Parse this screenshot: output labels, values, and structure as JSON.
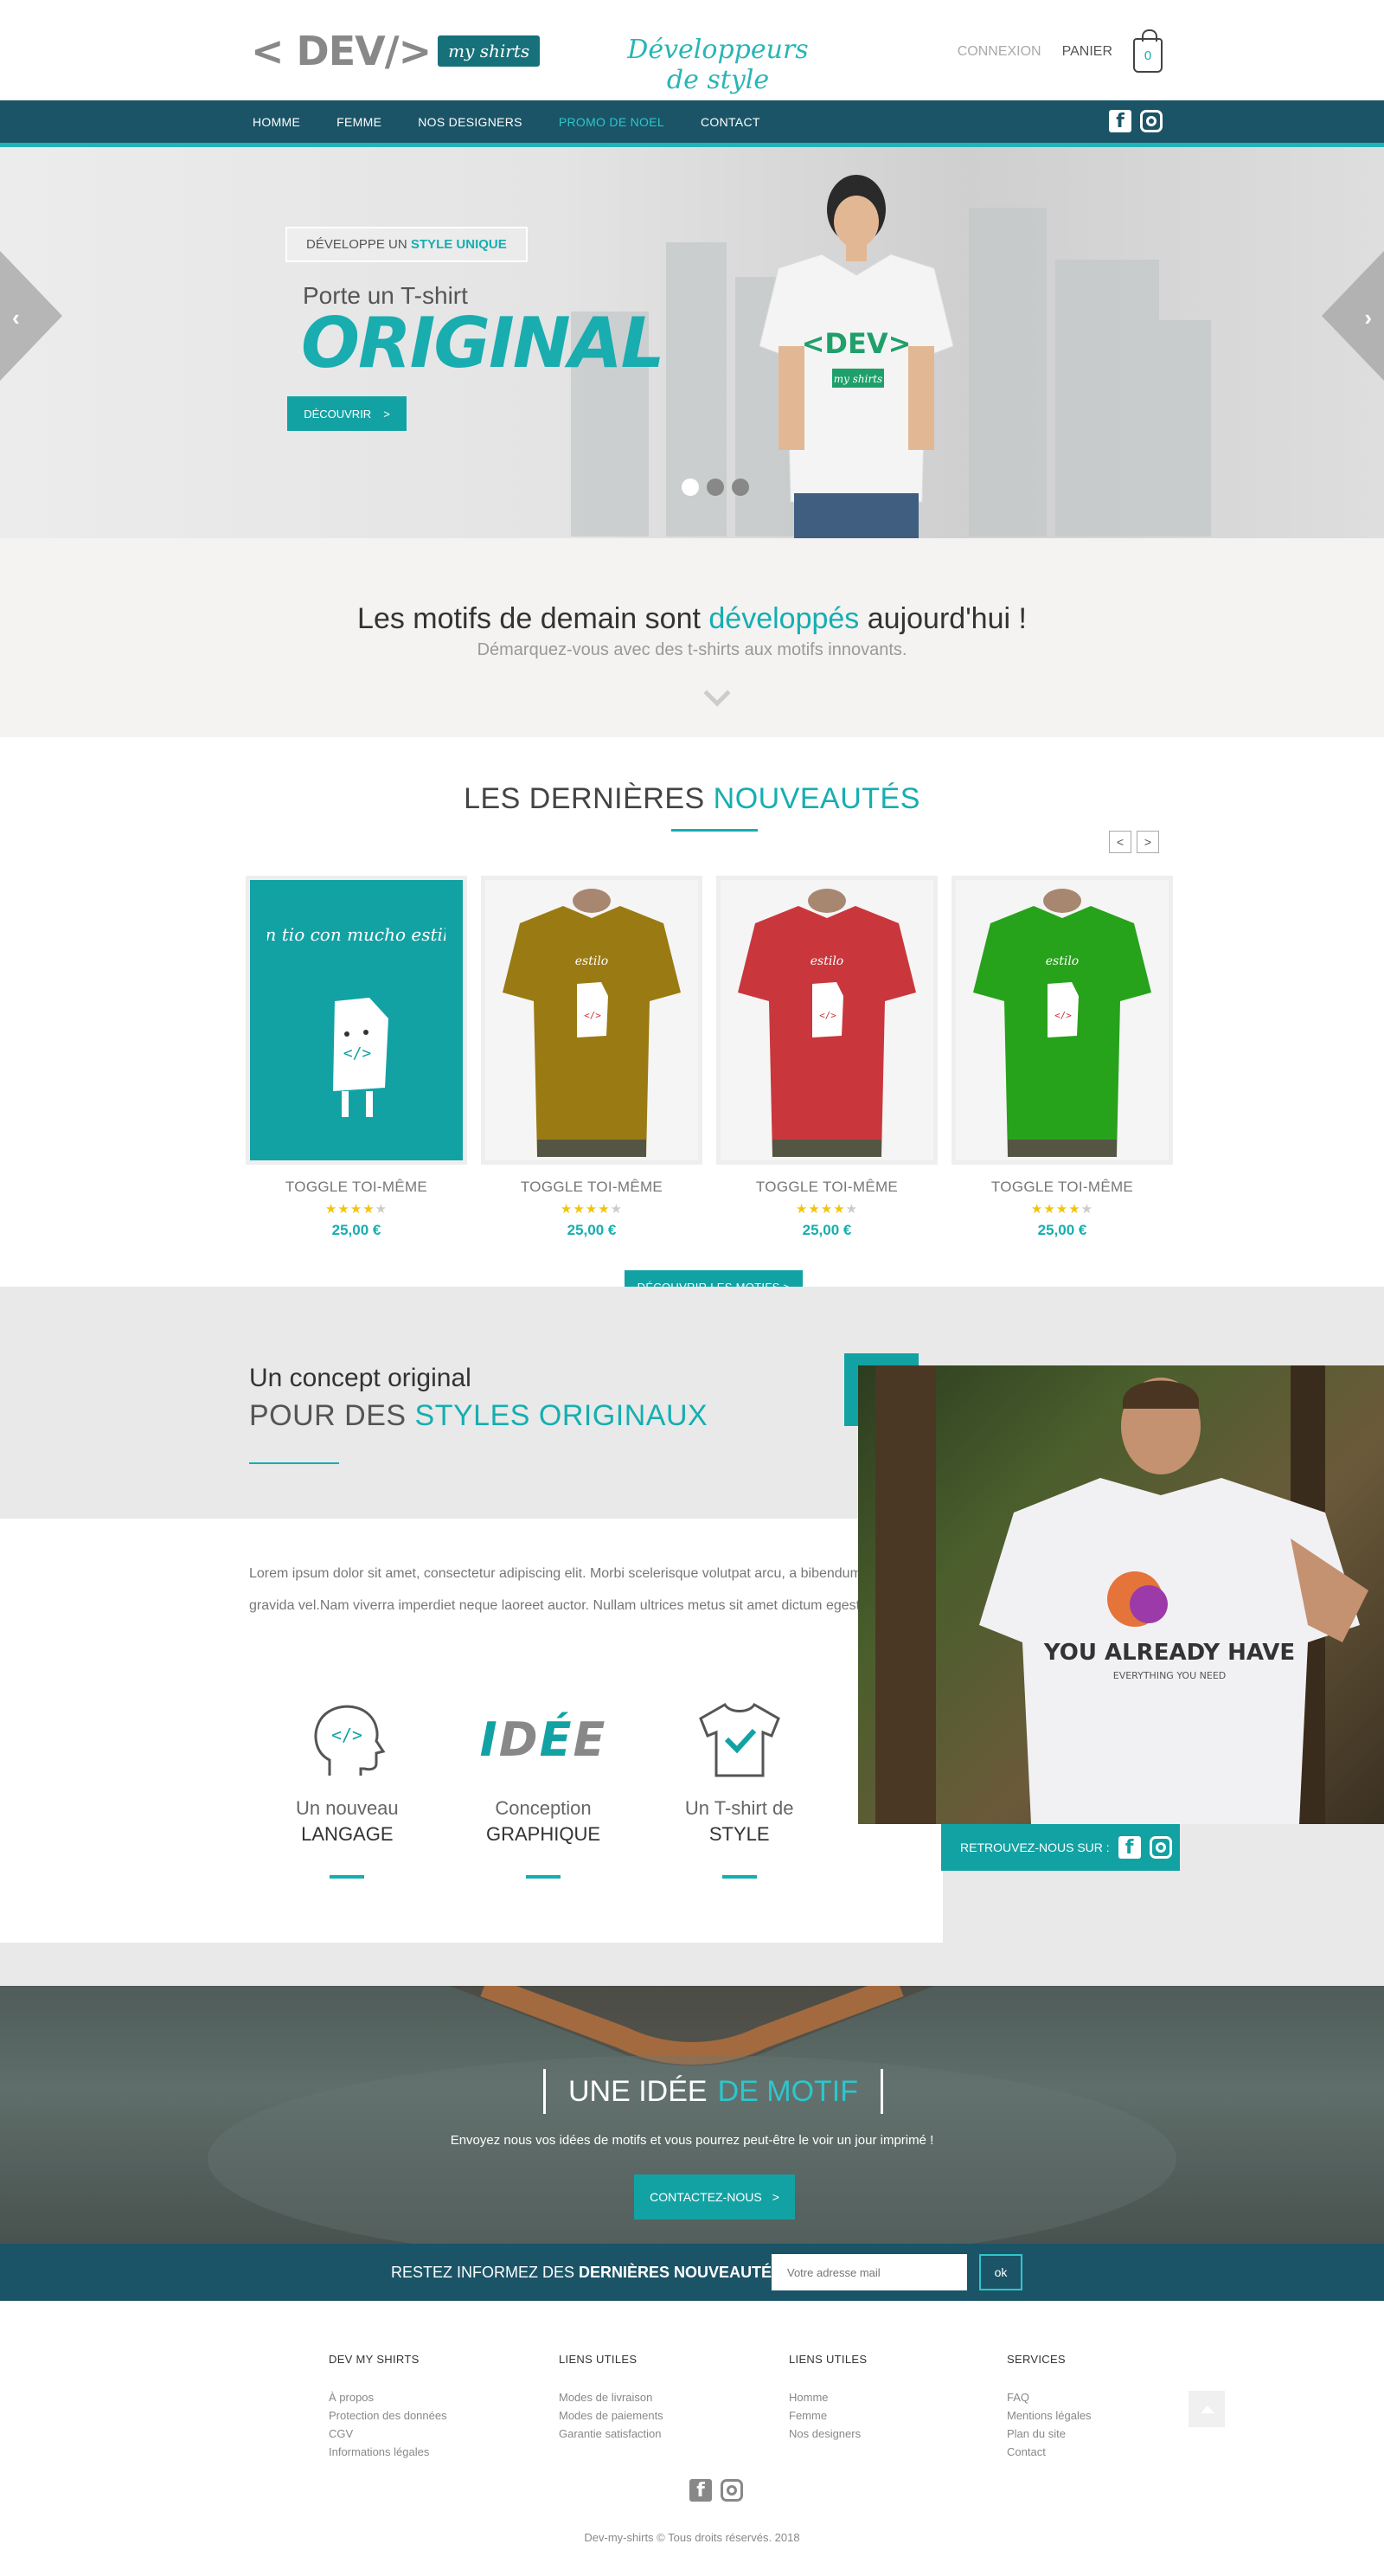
{
  "header": {
    "logo_left": "< DEV/>",
    "logo_badge": "my shirts",
    "tagline": "Développeurs de style",
    "login": "CONNEXION",
    "cart_label": "PANIER",
    "cart_count": "0"
  },
  "nav": {
    "items": [
      {
        "label": "HOMME",
        "active": false
      },
      {
        "label": "FEMME",
        "active": false
      },
      {
        "label": "NOS DESIGNERS",
        "active": false
      },
      {
        "label": "PROMO DE NOEL",
        "active": true
      },
      {
        "label": "CONTACT",
        "active": false
      }
    ],
    "social": [
      "facebook-icon",
      "instagram-icon"
    ]
  },
  "hero": {
    "tag_prefix": "DÉVELOPPE UN",
    "tag_highlight": "STYLE UNIQUE",
    "subtitle": "Porte un T-shirt",
    "title": "ORIGINAL",
    "button_label": "DÉCOUVRIR",
    "button_arrow": ">",
    "shirt_print": "<DEV>",
    "shirt_badge": "my shirts",
    "slides_count": 3,
    "active_slide": 1
  },
  "intro": {
    "title_before": "Les motifs de demain sont",
    "title_highlight": "développés",
    "title_after": "aujourd'hui !",
    "subtitle": "Démarquez-vous avec des t-shirts aux motifs innovants."
  },
  "news": {
    "title_before": "LES DERNIÈRES",
    "title_highlight": "NOUVEAUTÉS",
    "prev": "<",
    "next": ">",
    "products": [
      {
        "name": "TOGGLE TOI-MÊME",
        "rating": 4,
        "price": "25,00 €",
        "bg": "#13a2a4",
        "shirt": "none"
      },
      {
        "name": "TOGGLE TOI-MÊME",
        "rating": 4,
        "price": "25,00 €",
        "bg": "#f5f5f5",
        "shirt": "#9a7a12"
      },
      {
        "name": "TOGGLE TOI-MÊME",
        "rating": 4,
        "price": "25,00 €",
        "bg": "#f5f5f5",
        "shirt": "#c9373c"
      },
      {
        "name": "TOGGLE TOI-MÊME",
        "rating": 4,
        "price": "25,00 €",
        "bg": "#f5f5f5",
        "shirt": "#27a21b"
      }
    ],
    "design_text": "un tio con mucho estilo",
    "button": "DÉCOUVRIR LES MOTIFS >"
  },
  "concept": {
    "subtitle": "Un concept original",
    "title_before": "POUR DES",
    "title_highlight": "STYLES ORIGINAUX",
    "text": "Lorem ipsum dolor sit amet, consectetur adipiscing elit. Morbi scelerisque volutpat arcu, a bibendum nisi gravida vel.Nam viverra imperdiet neque laoreet auctor. Nullam ultrices metus sit amet dictum egestas.",
    "features": [
      {
        "icon": "head-code-icon",
        "line1": "Un nouveau",
        "line2": "LANGAGE"
      },
      {
        "icon": "idee-word-icon",
        "line1": "Conception",
        "line2": "GRAPHIQUE",
        "word": "IDÉE"
      },
      {
        "icon": "tshirt-check-icon",
        "line1": "Un T-shirt de",
        "line2": "STYLE"
      }
    ],
    "photo_print": "YOU ALREADY HAVE",
    "photo_print_sub": "EVERYTHING YOU NEED",
    "find_us": "RETROUVEZ-NOUS SUR :"
  },
  "idea": {
    "title_before": "UNE IDÉE",
    "title_highlight": "DE MOTIF",
    "text": "Envoyez nous vos idées de motifs et vous pourrez peut-être le voir un jour imprimé !",
    "button": "CONTACTEZ-NOUS",
    "button_arrow": ">"
  },
  "newsletter": {
    "label_before": "RESTEZ INFORMEZ DES",
    "label_bold": "DERNIÈRES NOUVEAUTÉS",
    "placeholder": "Votre adresse mail",
    "button": "ok"
  },
  "footer": {
    "columns": [
      {
        "title": "DEV MY SHIRTS",
        "links": [
          "À propos",
          "Protection des données",
          "CGV",
          "Informations légales"
        ]
      },
      {
        "title": "LIENS UTILES",
        "links": [
          "Modes de livraison",
          "Modes de paiements",
          "Garantie satisfaction"
        ]
      },
      {
        "title": "LIENS UTILES",
        "links": [
          "Homme",
          "Femme",
          "Nos designers"
        ]
      },
      {
        "title": "SERVICES",
        "links": [
          "FAQ",
          "Mentions légales",
          "Plan du site",
          "Contact"
        ]
      }
    ],
    "copyright": "Dev-my-shirts © Tous droits réservés. 2018"
  },
  "colors": {
    "accent": "#13a2a4",
    "accent_light": "#2ec6cc",
    "nav_bg": "#1b5467"
  }
}
